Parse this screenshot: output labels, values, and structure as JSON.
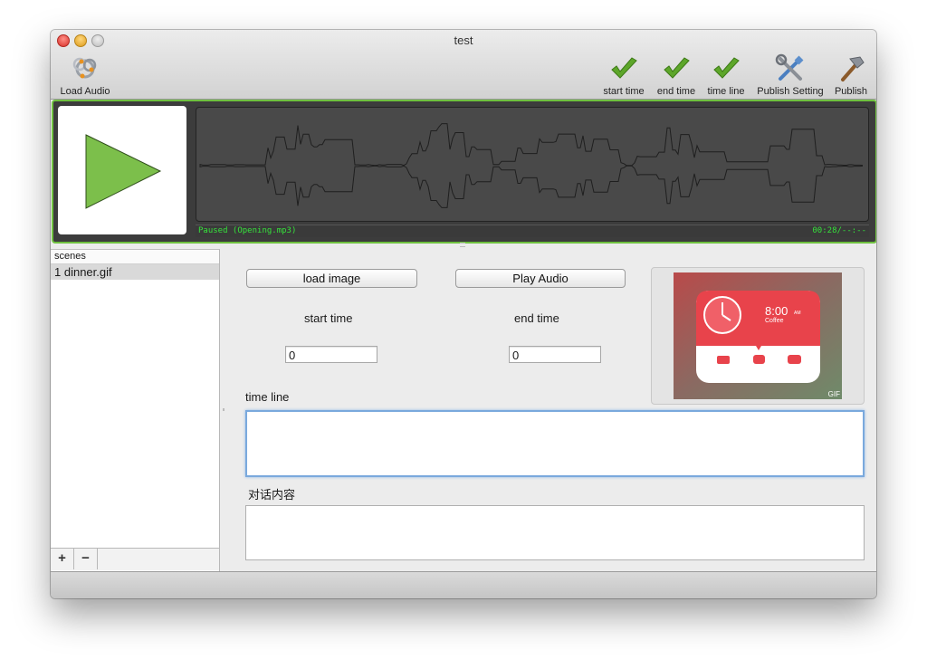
{
  "window": {
    "title": "test"
  },
  "toolbar": {
    "load_audio": "Load Audio",
    "start_time": "start time",
    "end_time": "end time",
    "time_line": "time line",
    "publish_setting": "Publish Setting",
    "publish": "Publish"
  },
  "player": {
    "status": "Paused (Opening.mp3)",
    "time": "00:28/--:--",
    "accent": "#6fc13f",
    "status_color": "#35e23a"
  },
  "sidebar": {
    "header": "scenes",
    "items": [
      {
        "label": "1 dinner.gif"
      }
    ],
    "add_label": "+",
    "remove_label": "−"
  },
  "editor": {
    "load_image": "load image",
    "play_audio": "Play Audio",
    "start_time_label": "start time",
    "end_time_label": "end time",
    "start_time_value": "0",
    "end_time_value": "0",
    "time_line_label": "time line",
    "dialog_label": "对话内容"
  },
  "preview": {
    "clock_time": "8:00",
    "clock_ampm": "AM",
    "caption": "Coffee",
    "badge": "GIF",
    "accent": "#e8434b"
  }
}
